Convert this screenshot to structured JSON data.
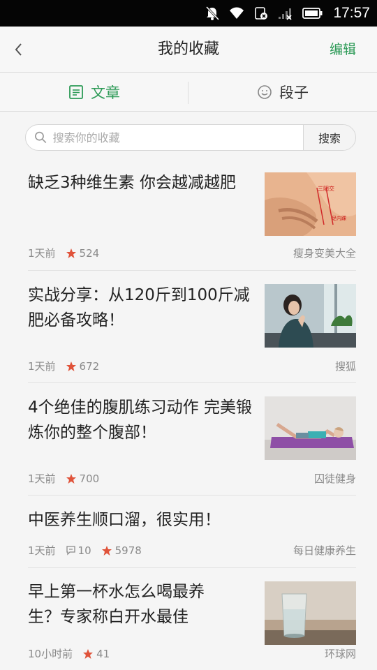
{
  "status_bar": {
    "time": "17:57",
    "icons": [
      "notifications-muted-icon",
      "wifi-icon",
      "sim-icon",
      "signal-icon",
      "battery-icon"
    ]
  },
  "header": {
    "title": "我的收藏",
    "edit_label": "编辑"
  },
  "tabs": [
    {
      "label": "文章",
      "icon": "article-icon"
    },
    {
      "label": "段子",
      "icon": "smiley-icon"
    }
  ],
  "search": {
    "placeholder": "搜索你的收藏",
    "value": "",
    "button_label": "搜索"
  },
  "articles": [
    {
      "title": "缺乏3种维生素 你会越减越肥",
      "time": "1天前",
      "stars": "524",
      "comments": "",
      "source": "瘦身变美大全",
      "thumb": "massage-hand-image"
    },
    {
      "title": "实战分享：从120斤到100斤减肥必备攻略！",
      "time": "1天前",
      "stars": "672",
      "comments": "",
      "source": "搜狐",
      "thumb": "woman-by-window-image"
    },
    {
      "title": "4个绝佳的腹肌练习动作 完美锻炼你的整个腹部！",
      "time": "1天前",
      "stars": "700",
      "comments": "",
      "source": "囚徒健身",
      "thumb": "woman-on-yoga-mat-image"
    },
    {
      "title": "中医养生顺口溜，很实用！",
      "time": "1天前",
      "stars": "5978",
      "comments": "10",
      "source": "每日健康养生",
      "thumb": ""
    },
    {
      "title": "早上第一杯水怎么喝最养生？专家称白开水最佳",
      "time": "10小时前",
      "stars": "41",
      "comments": "",
      "source": "环球网",
      "thumb": "glass-of-water-image"
    }
  ],
  "colors": {
    "accent": "#2c9a56",
    "star": "#e0533a",
    "status_bar": "#050505",
    "meta_text": "#8a8a8a"
  }
}
